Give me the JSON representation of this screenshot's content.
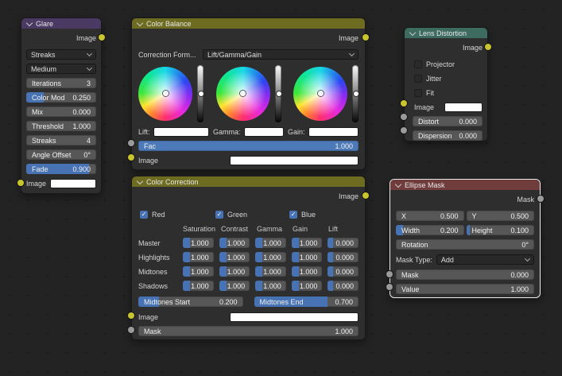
{
  "glare": {
    "title": "Glare",
    "output": "Image",
    "type_dropdown": "Streaks",
    "quality_dropdown": "Medium",
    "iterations": {
      "label": "Iterations",
      "value": "3"
    },
    "color_mod": {
      "label": "Color Mod",
      "value": "0.250"
    },
    "mix": {
      "label": "Mix",
      "value": "0.000"
    },
    "threshold": {
      "label": "Threshold",
      "value": "1.000"
    },
    "streaks": {
      "label": "Streaks",
      "value": "4"
    },
    "angle_offset": {
      "label": "Angle Offset",
      "value": "0°"
    },
    "fade": {
      "label": "Fade",
      "value": "0.900"
    },
    "input": "Image"
  },
  "color_balance": {
    "title": "Color Balance",
    "output": "Image",
    "correction_label": "Correction Form...",
    "correction_value": "Lift/Gamma/Gain",
    "wheel_labels": [
      "Lift:",
      "Gamma:",
      "Gain:"
    ],
    "fac": {
      "label": "Fac",
      "value": "1.000"
    },
    "input": "Image"
  },
  "lens_distortion": {
    "title": "Lens Distortion",
    "output": "Image",
    "checkboxes": [
      "Projector",
      "Jitter",
      "Fit"
    ],
    "input": "Image",
    "distort": {
      "label": "Distort",
      "value": "0.000"
    },
    "dispersion": {
      "label": "Dispersion",
      "value": "0.000"
    }
  },
  "ellipse_mask": {
    "title": "Ellipse Mask",
    "output": "Mask",
    "x": {
      "label": "X",
      "value": "0.500"
    },
    "y": {
      "label": "Y",
      "value": "0.500"
    },
    "width": {
      "label": "Width",
      "value": "0.200"
    },
    "height": {
      "label": "Height",
      "value": "0.100"
    },
    "rotation": {
      "label": "Rotation",
      "value": "0°"
    },
    "mask_type_label": "Mask Type:",
    "mask_type_value": "Add",
    "mask": {
      "label": "Mask",
      "value": "0.000"
    },
    "value": {
      "label": "Value",
      "value": "1.000"
    }
  },
  "color_correction": {
    "title": "Color Correction",
    "output": "Image",
    "channels": [
      "Red",
      "Green",
      "Blue"
    ],
    "columns": [
      "Saturation",
      "Contrast",
      "Gamma",
      "Gain",
      "Lift"
    ],
    "rows": [
      {
        "label": "Master",
        "values": [
          "1.000",
          "1.000",
          "1.000",
          "1.000",
          "0.000"
        ]
      },
      {
        "label": "Highlights",
        "values": [
          "1.000",
          "1.000",
          "1.000",
          "1.000",
          "0.000"
        ]
      },
      {
        "label": "Midtones",
        "values": [
          "1.000",
          "1.000",
          "1.000",
          "1.000",
          "0.000"
        ]
      },
      {
        "label": "Shadows",
        "values": [
          "1.000",
          "1.000",
          "1.000",
          "1.000",
          "0.000"
        ]
      }
    ],
    "midtones_start": {
      "label": "Midtones Start",
      "value": "0.200"
    },
    "midtones_end": {
      "label": "Midtones End",
      "value": "0.700"
    },
    "input": "Image",
    "mask": {
      "label": "Mask",
      "value": "1.000"
    }
  }
}
